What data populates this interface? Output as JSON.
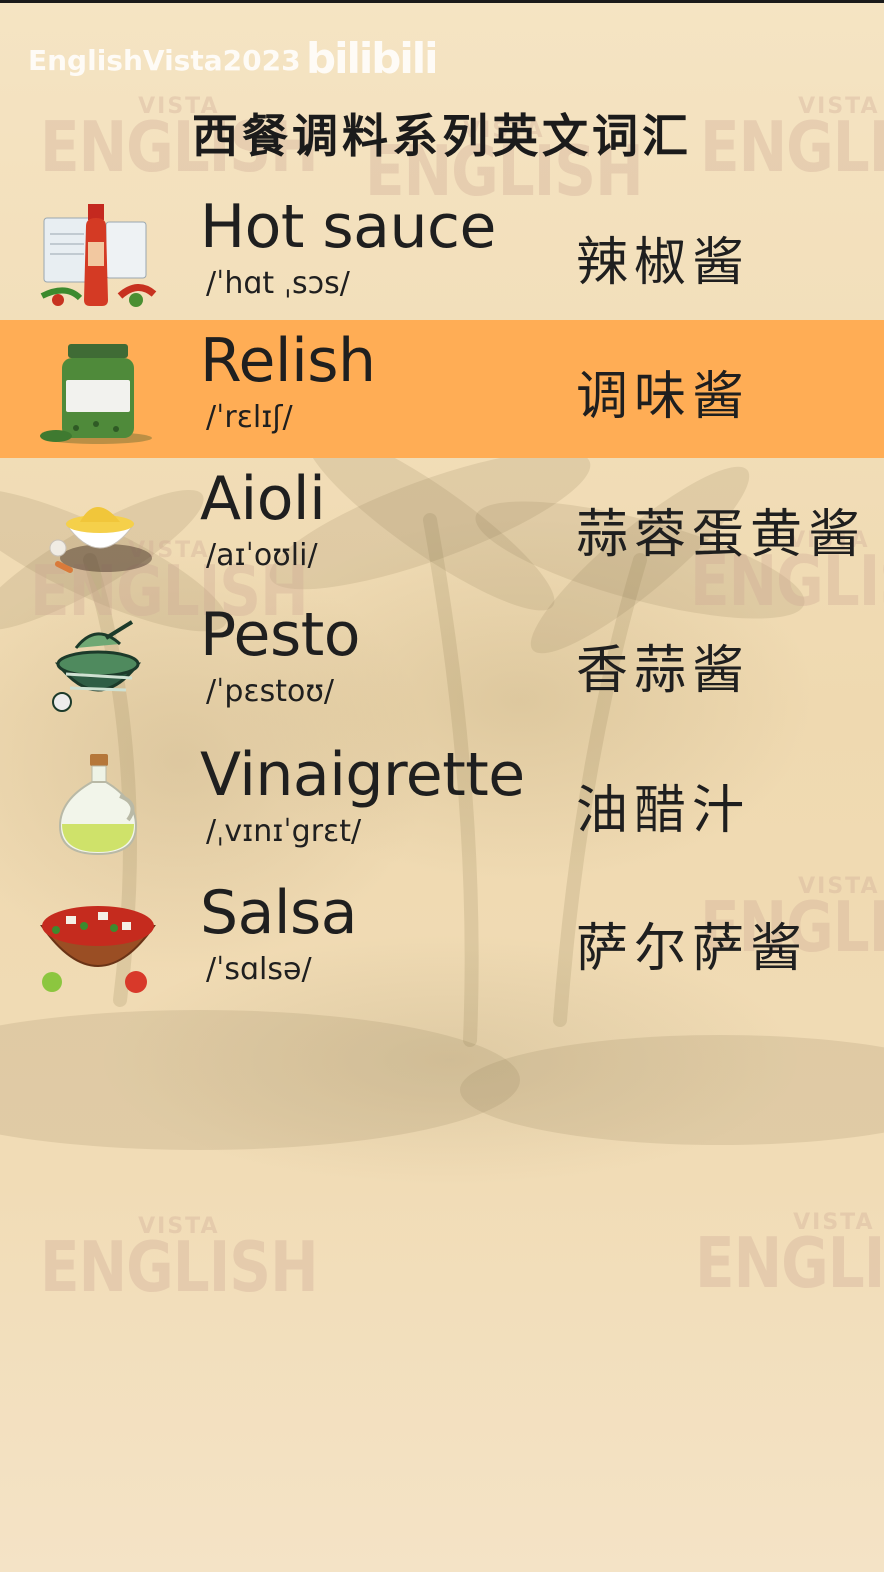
{
  "header": {
    "channel": "EnglishVista2023",
    "platform_logo": "bilibili",
    "title": "西餐调料系列英文词汇"
  },
  "watermark": {
    "small": "VISTA",
    "big": "ENGLISH"
  },
  "vocabulary": [
    {
      "word": "Hot sauce",
      "ipa": "/ˈhɑt ˌsɔs/",
      "chinese": "辣椒酱",
      "icon": "hot-sauce-bottle-icon",
      "highlighted": false
    },
    {
      "word": "Relish",
      "ipa": "/ˈrɛlɪʃ/",
      "chinese": "调味酱",
      "icon": "relish-jar-icon",
      "highlighted": true
    },
    {
      "word": "Aioli",
      "ipa": "/aɪˈoʊli/",
      "chinese": "蒜蓉蛋黄酱",
      "icon": "aioli-bowl-icon",
      "highlighted": false
    },
    {
      "word": "Pesto",
      "ipa": "/ˈpɛstoʊ/",
      "chinese": "香蒜酱",
      "icon": "pesto-bowl-icon",
      "highlighted": false
    },
    {
      "word": "Vinaigrette",
      "ipa": "/ˌvɪnɪˈgrɛt/",
      "chinese": "油醋汁",
      "icon": "oil-bottle-icon",
      "highlighted": false
    },
    {
      "word": "Salsa",
      "ipa": "/ˈsɑlsə/",
      "chinese": "萨尔萨酱",
      "icon": "salsa-bowl-icon",
      "highlighted": false
    }
  ],
  "colors": {
    "highlight": "#ffad55",
    "background": "#f3dfbb",
    "text": "#1f1f1f"
  }
}
